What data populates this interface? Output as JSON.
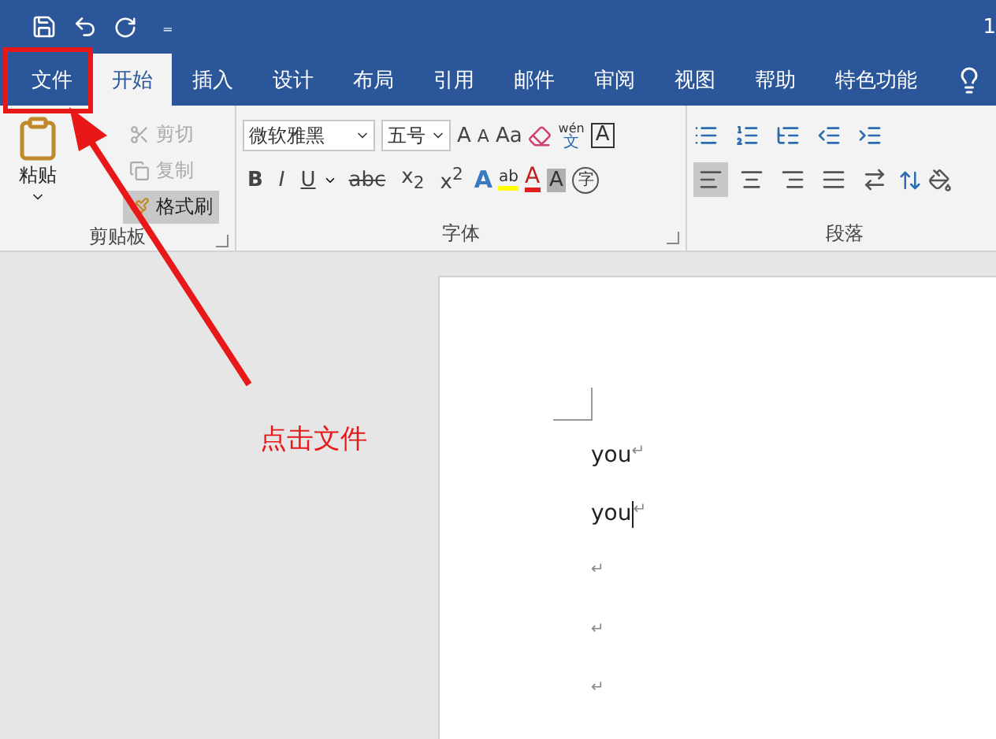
{
  "title_bar": {
    "customize": "₌",
    "title": "1"
  },
  "tabs": [
    {
      "label": "文件",
      "selected": false
    },
    {
      "label": "开始",
      "selected": true
    },
    {
      "label": "插入",
      "selected": false
    },
    {
      "label": "设计",
      "selected": false
    },
    {
      "label": "布局",
      "selected": false
    },
    {
      "label": "引用",
      "selected": false
    },
    {
      "label": "邮件",
      "selected": false
    },
    {
      "label": "审阅",
      "selected": false
    },
    {
      "label": "视图",
      "selected": false
    },
    {
      "label": "帮助",
      "selected": false
    },
    {
      "label": "特色功能",
      "selected": false
    }
  ],
  "clipboard": {
    "paste": "粘贴",
    "label": "剪贴板",
    "items": [
      {
        "kind": "cut",
        "label": "剪切",
        "disabled": true,
        "active": false
      },
      {
        "kind": "copy",
        "label": "复制",
        "disabled": true,
        "active": false
      },
      {
        "kind": "painter",
        "label": "格式刷",
        "disabled": false,
        "active": true
      }
    ]
  },
  "font": {
    "label": "字体",
    "font_name": "微软雅黑",
    "font_size": "五号",
    "grow": "A",
    "shrink": "A",
    "case": "Aa",
    "phonetic_top": "wén",
    "phonetic_bottom": "文",
    "border_char": "A",
    "format_buttons": [
      {
        "label": "B",
        "kind": "bold",
        "dropdown": false
      },
      {
        "label": "I",
        "kind": "italic",
        "dropdown": false
      },
      {
        "label": "U",
        "kind": "underline",
        "dropdown": true
      },
      {
        "label": "abc",
        "kind": "strike",
        "dropdown": false
      },
      {
        "label": "x$_{2}$",
        "kind": "plain",
        "dropdown": false
      },
      {
        "label": "x$^{2}$",
        "kind": "plain",
        "dropdown": false
      }
    ],
    "effects": "A",
    "highlight": "ab",
    "font_color_char": "A",
    "shading_char": "A",
    "enclose_char": "字"
  },
  "paragraph": {
    "label": "段落",
    "alignments": [
      {
        "kind": "left",
        "selected": true
      },
      {
        "kind": "center",
        "selected": false
      },
      {
        "kind": "right",
        "selected": false
      },
      {
        "kind": "justify",
        "selected": false
      },
      {
        "kind": "distributed",
        "selected": false
      }
    ]
  },
  "document": {
    "paragraphs": [
      {
        "text": "you",
        "mark": "↵",
        "cursor": false
      },
      {
        "text": "you",
        "mark": "↵",
        "cursor": true
      },
      {
        "mark": "↵",
        "cursor": false
      },
      {
        "mark": "↵",
        "cursor": false
      },
      {
        "mark": "↵",
        "cursor": false
      }
    ]
  },
  "annotation": {
    "text": "点击文件"
  }
}
